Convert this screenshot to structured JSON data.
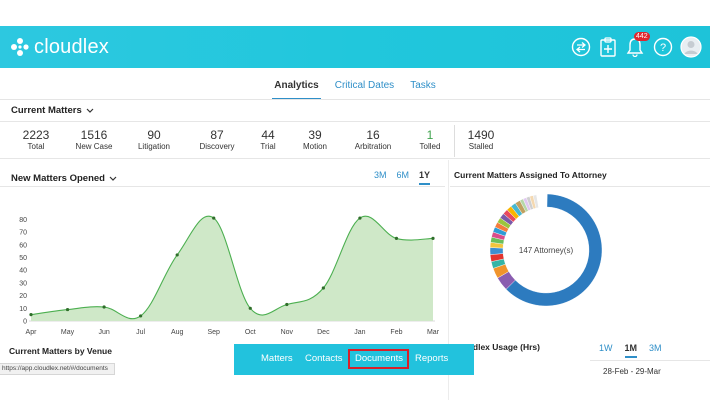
{
  "app": {
    "logo_text": "cloudlex",
    "notification_count": "442",
    "header_color": "#22c6dc",
    "accent_color": "#2f8fc8"
  },
  "header_icons": [
    "switch-arrows-icon",
    "clipboard-plus-icon",
    "bell-icon",
    "help-icon",
    "user-avatar-icon"
  ],
  "tabs": [
    {
      "label": "Analytics",
      "active": true
    },
    {
      "label": "Critical Dates",
      "active": false
    },
    {
      "label": "Tasks",
      "active": false
    }
  ],
  "current_matters": {
    "title": "Current Matters",
    "stats": [
      {
        "value": "2223",
        "label": "Total"
      },
      {
        "value": "1516",
        "label": "New Case"
      },
      {
        "value": "90",
        "label": "Litigation"
      },
      {
        "value": "87",
        "label": "Discovery"
      },
      {
        "value": "44",
        "label": "Trial"
      },
      {
        "value": "39",
        "label": "Motion"
      },
      {
        "value": "16",
        "label": "Arbitration"
      },
      {
        "value": "1",
        "label": "Tolled"
      },
      {
        "value": "1490",
        "label": "Stalled"
      }
    ]
  },
  "new_matters": {
    "title": "New Matters Opened",
    "ranges": [
      {
        "label": "3M",
        "active": false
      },
      {
        "label": "6M",
        "active": false
      },
      {
        "label": "1Y",
        "active": true
      }
    ]
  },
  "chart_data": [
    {
      "type": "area",
      "title": "New Matters Opened",
      "categories": [
        "Apr",
        "May",
        "Jun",
        "Jul",
        "Aug",
        "Sep",
        "Oct",
        "Nov",
        "Dec",
        "Jan",
        "Feb",
        "Mar"
      ],
      "values": [
        5,
        9,
        11,
        4,
        52,
        81,
        10,
        13,
        26,
        81,
        65,
        65
      ],
      "yticks": [
        0,
        10,
        20,
        30,
        40,
        50,
        60,
        70,
        80
      ],
      "ylim": [
        0,
        85
      ],
      "grid": false,
      "color": "#4caf50",
      "fill": "#cfe8c8"
    },
    {
      "type": "pie",
      "title": "Current Matters Assigned To Attorney",
      "center_label": "147 Attorney(s)",
      "donut": true,
      "slices": [
        {
          "value": 62,
          "color": "#2d7bbf"
        },
        {
          "value": 4,
          "color": "#8a5db0"
        },
        {
          "value": 3,
          "color": "#f0942c"
        },
        {
          "value": 2,
          "color": "#35b5a6"
        },
        {
          "value": 2,
          "color": "#e2342f"
        },
        {
          "value": 2,
          "color": "#3c8fd0"
        },
        {
          "value": 1.5,
          "color": "#f2c53d"
        },
        {
          "value": 1.5,
          "color": "#6bbf59"
        },
        {
          "value": 1.5,
          "color": "#d94c8a"
        },
        {
          "value": 1.5,
          "color": "#2e9bd6"
        },
        {
          "value": 1.5,
          "color": "#f47c3c"
        },
        {
          "value": 1.5,
          "color": "#9bc53d"
        },
        {
          "value": 1.5,
          "color": "#7a59a9"
        },
        {
          "value": 1.5,
          "color": "#e84a5f"
        },
        {
          "value": 1.5,
          "color": "#f8b500"
        },
        {
          "value": 1.5,
          "color": "#45b7d1"
        },
        {
          "value": 1.5,
          "color": "#c0a060"
        },
        {
          "value": 1,
          "color": "#b6d7a8"
        },
        {
          "value": 1,
          "color": "#e0c8f0"
        },
        {
          "value": 1,
          "color": "#cfcfcf"
        },
        {
          "value": 1,
          "color": "#f4d8b0"
        },
        {
          "value": 1,
          "color": "#e6e6e6"
        },
        {
          "value": 3,
          "color": "#ffffff"
        }
      ]
    }
  ],
  "attorney_panel": {
    "title": "Current Matters Assigned To Attorney",
    "center_label": "147 Attorney(s)"
  },
  "venue": {
    "title": "Current Matters by Venue"
  },
  "usage": {
    "title": "Cloudlex Usage (Hrs)",
    "ranges": [
      {
        "label": "1W",
        "active": false
      },
      {
        "label": "1M",
        "active": true
      },
      {
        "label": "3M",
        "active": false
      }
    ],
    "dates": "28-Feb - 29-Mar"
  },
  "quickbar": {
    "items": [
      "Matters",
      "Contacts",
      "Documents",
      "Reports"
    ],
    "highlighted": "Documents"
  },
  "status_url": "https://app.cloudlex.net/#/documents"
}
